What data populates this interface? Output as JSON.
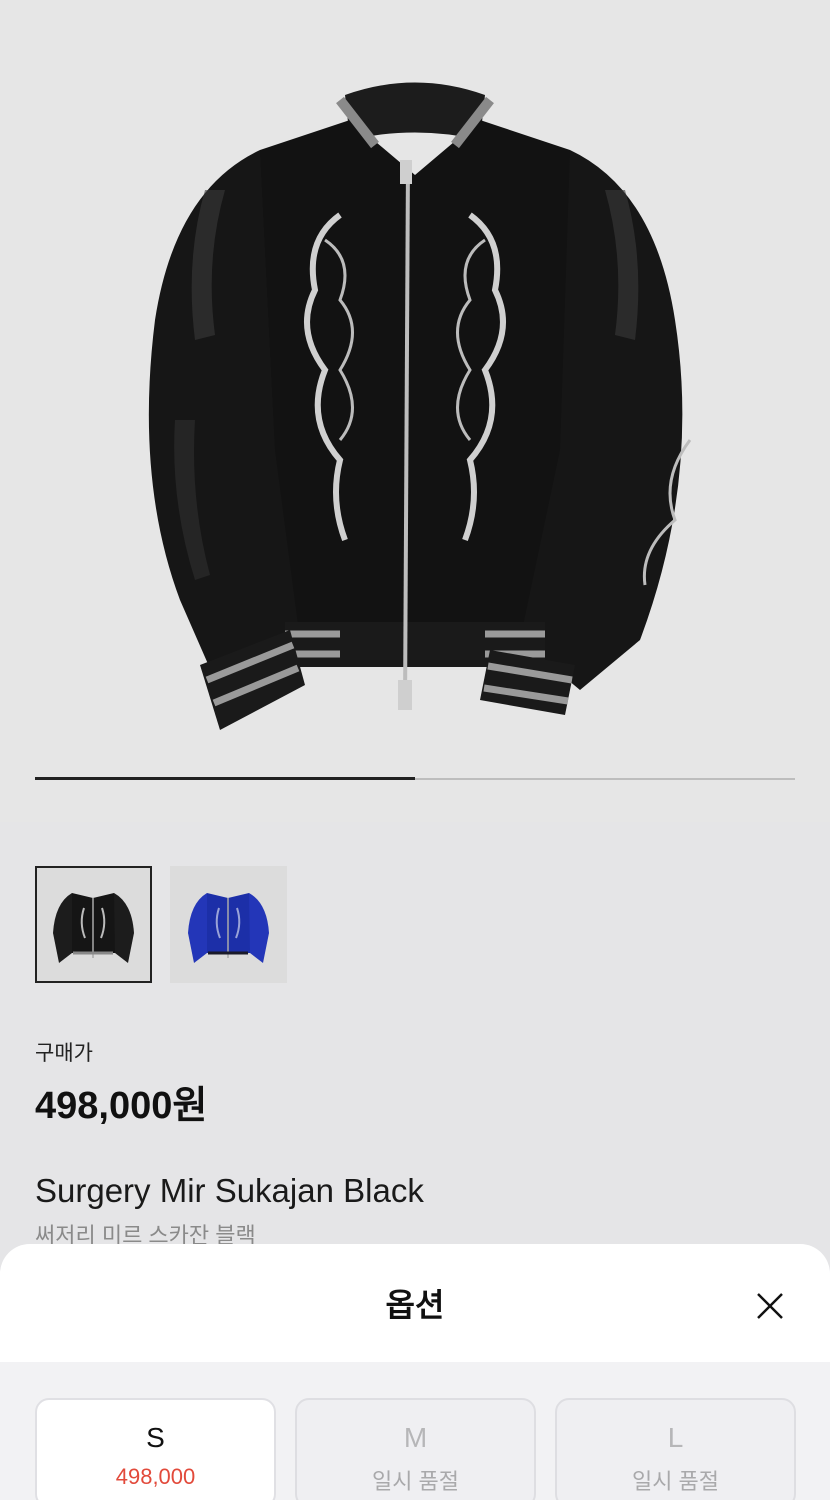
{
  "product": {
    "image_alt": "black sukajan jacket with dragon embroidery",
    "carousel": {
      "current": 1,
      "total": 2
    },
    "thumbnails": [
      {
        "color": "black",
        "selected": true
      },
      {
        "color": "blue",
        "selected": false
      }
    ],
    "price_label": "구매가",
    "price": "498,000원",
    "name": "Surgery Mir Sukajan Black",
    "name_ko": "써저리 미르 스카잔 블랙"
  },
  "option_sheet": {
    "title": "옵션",
    "close_icon": "close-icon",
    "options": [
      {
        "size": "S",
        "status": "498,000",
        "available": true
      },
      {
        "size": "M",
        "status": "일시 품절",
        "available": false
      },
      {
        "size": "L",
        "status": "일시 품절",
        "available": false
      }
    ]
  },
  "colors": {
    "price_accent": "#e24a3b",
    "background": "#e5e5e7",
    "sheet": "#f2f2f4"
  }
}
